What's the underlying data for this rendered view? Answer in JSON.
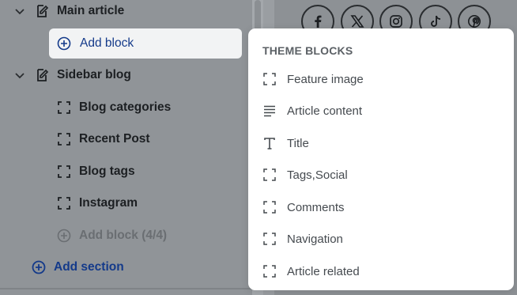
{
  "tree": {
    "main_article": {
      "label": "Main article",
      "icon": "document-edit-icon"
    },
    "add_block": {
      "label": "Add block",
      "icon": "plus-circle-icon"
    },
    "sidebar_blog": {
      "label": "Sidebar blog",
      "icon": "document-edit-icon"
    },
    "items": [
      {
        "label": "Blog categories",
        "icon": "dashed-square-icon"
      },
      {
        "label": "Recent Post",
        "icon": "dashed-square-icon"
      },
      {
        "label": "Blog tags",
        "icon": "dashed-square-icon"
      },
      {
        "label": "Instagram",
        "icon": "dashed-square-icon"
      }
    ],
    "add_block_limit": {
      "label": "Add block (4/4)",
      "icon": "plus-circle-icon"
    },
    "add_section": {
      "label": "Add section",
      "icon": "plus-circle-icon"
    }
  },
  "preview": {
    "social_icons": [
      "facebook-icon",
      "x-icon",
      "instagram-icon",
      "tiktok-icon",
      "pinterest-icon"
    ]
  },
  "popover": {
    "title": "THEME BLOCKS",
    "items": [
      {
        "label": "Feature image",
        "icon": "dashed-square-icon"
      },
      {
        "label": "Article content",
        "icon": "text-lines-icon"
      },
      {
        "label": "Title",
        "icon": "title-t-icon"
      },
      {
        "label": "Tags,Social",
        "icon": "dashed-square-icon"
      },
      {
        "label": "Comments",
        "icon": "dashed-square-icon"
      },
      {
        "label": "Navigation",
        "icon": "dashed-square-icon"
      },
      {
        "label": "Article related",
        "icon": "dashed-square-icon"
      }
    ]
  },
  "colors": {
    "accent_blue": "#143a8a",
    "overlay": "#909498",
    "popover_bg": "#ffffff"
  }
}
